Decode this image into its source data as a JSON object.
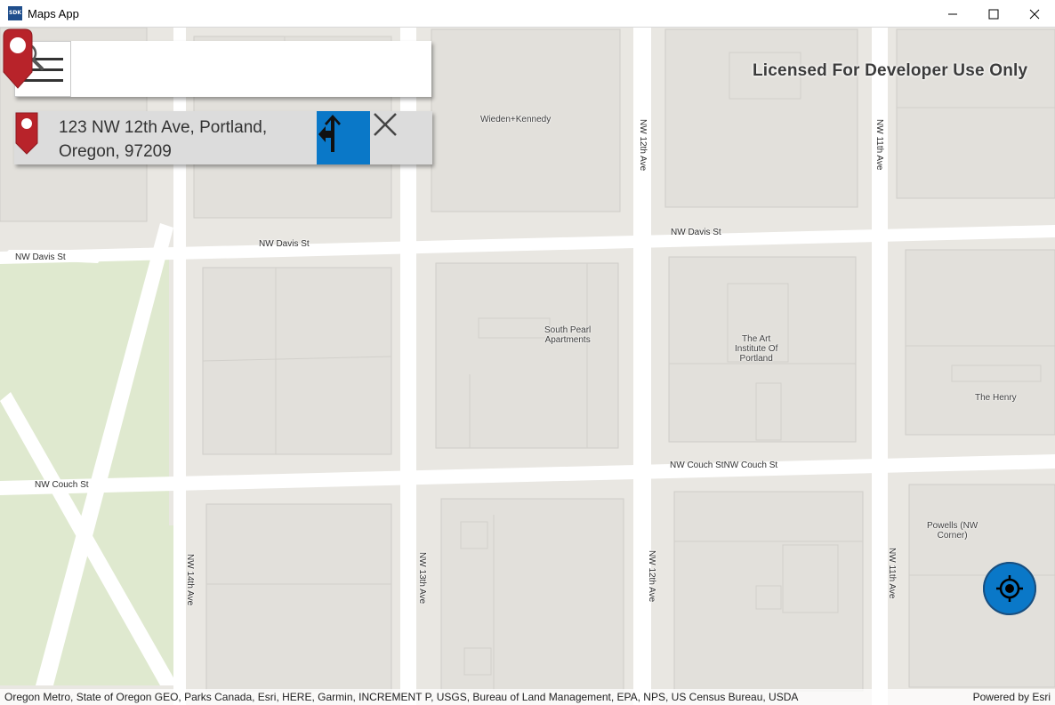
{
  "window": {
    "title": "Maps App",
    "icon_label": "SDK",
    "controls": {
      "minimize": "─",
      "maximize": "☐",
      "close": "✕"
    }
  },
  "map": {
    "license_text": "Licensed For Developer Use Only",
    "poi_labels": {
      "wieden": "Wieden+Kennedy",
      "south_pearl": "South Pearl\nApartments",
      "art_institute": "The Art\nInstitute Of\nPortland",
      "henry": "The Henry",
      "powells": "Powells (NW\nCorner)"
    },
    "road_labels": {
      "davis_west": "NW Davis St",
      "davis_left": "NW Davis St",
      "davis_east": "NW Davis St",
      "couch_west": "NW Couch St",
      "couch_east": "NW Couch StNW Couch St",
      "ave12_top": "NW 12th Ave",
      "ave11_top": "NW 11th Ave",
      "ave14_bottom": "NW 14th Ave",
      "ave13_bottom": "NW 13th Ave",
      "ave12_bottom": "NW 12th Ave",
      "ave11_bottom": "NW 11th Ave"
    },
    "attribution": "Oregon Metro, State of Oregon GEO, Parks Canada, Esri, HERE, Garmin, INCREMENT P, USGS, Bureau of Land Management, EPA, NPS, US Census Bureau, USDA",
    "powered_by": "Powered by Esri",
    "colors": {
      "background": "#e9e7e2",
      "building": "#e2e0db",
      "building_stroke": "#cfcdc8",
      "road": "#ffffff",
      "park": "#dfe9cf",
      "pin": "#b8232a",
      "accent": "#0a78c8"
    }
  },
  "search": {
    "placeholder": "",
    "value": ""
  },
  "result": {
    "address": "123 NW 12th Ave, Portland, Oregon, 97209"
  },
  "icons": {
    "menu": "hamburger-icon",
    "search": "magnifier-icon",
    "pin": "map-pin-icon",
    "route": "route-turn-left-icon",
    "clear": "close-icon",
    "locate": "crosshair-locate-icon"
  }
}
